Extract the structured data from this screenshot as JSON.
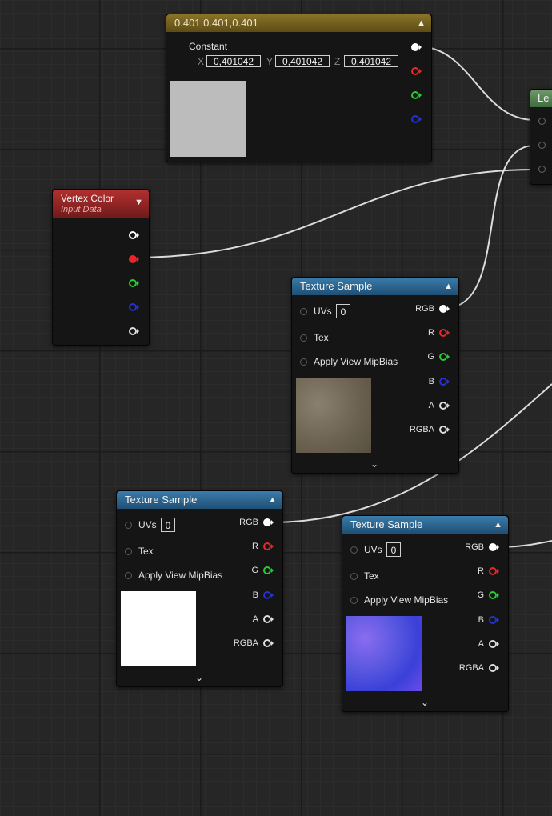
{
  "colors": {
    "pin_white": "#ffffff",
    "pin_red": "#e8262a",
    "pin_green": "#26cc30",
    "pin_blue": "#2430d8",
    "header_blue": "#2d6690",
    "header_gold": "#7a6620",
    "header_red": "#9c2625",
    "header_green": "#5a8a56",
    "texture_a": "#7a7060",
    "texture_white": "#ffffff",
    "texture_normal": "#5a58e0"
  },
  "constant_node": {
    "title": "0.401,0.401,0.401",
    "label": "Constant",
    "x_label": "X",
    "y_label": "Y",
    "z_label": "Z",
    "x_value": "0,401042",
    "y_value": "0,401042",
    "z_value": "0,401042",
    "collapse_icon": "chevron-up-icon"
  },
  "lerp_node": {
    "title": "Le"
  },
  "vertex_color_node": {
    "title": "Vertex Color",
    "subtitle": "Input Data",
    "collapse_icon": "chevron-down-icon"
  },
  "texture_sample_1": {
    "title": "Texture Sample",
    "uvs_label": "UVs",
    "uvs_value": "0",
    "tex_label": "Tex",
    "mipbias_label": "Apply View MipBias",
    "outputs": [
      "RGB",
      "R",
      "G",
      "B",
      "A",
      "RGBA"
    ],
    "preview": "concrete-texture"
  },
  "texture_sample_2": {
    "title": "Texture Sample",
    "uvs_label": "UVs",
    "uvs_value": "0",
    "tex_label": "Tex",
    "mipbias_label": "Apply View MipBias",
    "outputs": [
      "RGB",
      "R",
      "G",
      "B",
      "A",
      "RGBA"
    ],
    "preview": "white-texture"
  },
  "texture_sample_3": {
    "title": "Texture Sample",
    "uvs_label": "UVs",
    "uvs_value": "0",
    "tex_label": "Tex",
    "mipbias_label": "Apply View MipBias",
    "outputs": [
      "RGB",
      "R",
      "G",
      "B",
      "A",
      "RGBA"
    ],
    "preview": "normal-map-texture"
  }
}
